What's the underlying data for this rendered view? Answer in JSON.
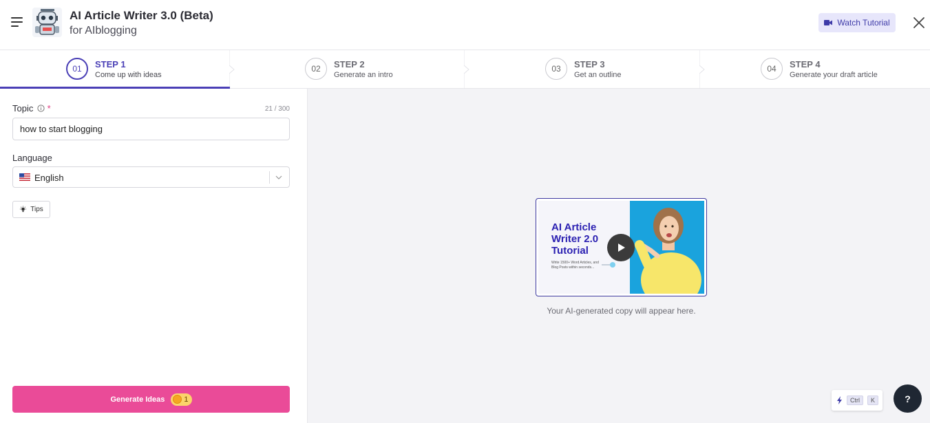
{
  "header": {
    "title": "AI Article Writer 3.0 (Beta)",
    "subtitle": "for AIblogging",
    "watch_tutorial_label": "Watch Tutorial"
  },
  "steps": [
    {
      "number": "01",
      "title": "STEP 1",
      "desc": "Come up with ideas",
      "active": true
    },
    {
      "number": "02",
      "title": "STEP 2",
      "desc": "Generate an intro",
      "active": false
    },
    {
      "number": "03",
      "title": "STEP 3",
      "desc": "Get an outline",
      "active": false
    },
    {
      "number": "04",
      "title": "STEP 4",
      "desc": "Generate your draft article",
      "active": false
    }
  ],
  "form": {
    "topic_label": "Topic",
    "topic_required": "*",
    "topic_counter": "21 / 300",
    "topic_value": "how to start blogging",
    "language_label": "Language",
    "language_value": "English",
    "tips_label": "Tips",
    "generate_label": "Generate Ideas",
    "generate_credits": "1"
  },
  "preview": {
    "video_title": "AI Article Writer 2.0 Tutorial",
    "video_subtitle": "Write 1500+ Word Articles, and Blog Posts within seconds...",
    "placeholder": "Your AI-generated copy will appear here."
  },
  "shortcut": {
    "key1": "Ctrl",
    "key2": "K"
  },
  "help_label": "?",
  "colors": {
    "accent": "#4a3fb6",
    "cta": "#ea4b98",
    "panel_bg": "#f3f3f6"
  }
}
